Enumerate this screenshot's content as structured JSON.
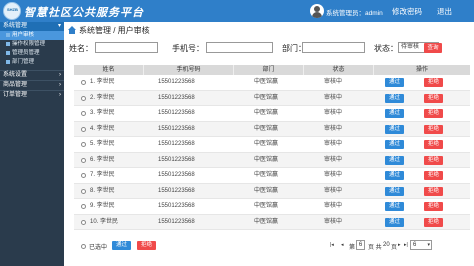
{
  "header": {
    "logo_badge": "SHZB",
    "logo_text": "智慧社区公共服务平台",
    "user_label": "系统管理员：admin",
    "change_password": "修改密码",
    "logout": "退出"
  },
  "sidebar": {
    "group1": "系统管理",
    "items": [
      "用户审核",
      "操作权限管理",
      "管理员管理",
      "部门管理"
    ],
    "group2": "系统设置",
    "group3": "商品管理",
    "group4": "订单管理"
  },
  "breadcrumb": "系统管理 / 用户审核",
  "filters": {
    "name_label": "姓名：",
    "phone_label": "手机号：",
    "dept_label": "部门：",
    "status_label": "状态：",
    "status_value": "待审核",
    "search_btn": "查询"
  },
  "table": {
    "columns": [
      "姓名",
      "手机号码",
      "部门",
      "状态",
      "操作"
    ],
    "rows": [
      {
        "name": "1. 李世民",
        "phone": "15501223568",
        "dept": "中医馆赢",
        "status": "审核中"
      },
      {
        "name": "2. 李世民",
        "phone": "15501223568",
        "dept": "中医馆赢",
        "status": "审核中"
      },
      {
        "name": "3. 李世民",
        "phone": "15501223568",
        "dept": "中医馆赢",
        "status": "审核中"
      },
      {
        "name": "4. 李世民",
        "phone": "15501223568",
        "dept": "中医馆赢",
        "status": "审核中"
      },
      {
        "name": "5. 李世民",
        "phone": "15501223568",
        "dept": "中医馆赢",
        "status": "审核中"
      },
      {
        "name": "6. 李世民",
        "phone": "15501223568",
        "dept": "中医馆赢",
        "status": "审核中"
      },
      {
        "name": "7. 李世民",
        "phone": "15501223568",
        "dept": "中医馆赢",
        "status": "审核中"
      },
      {
        "name": "8. 李世民",
        "phone": "15501223568",
        "dept": "中医馆赢",
        "status": "审核中"
      },
      {
        "name": "9. 李世民",
        "phone": "15501223568",
        "dept": "中医馆赢",
        "status": "审核中"
      },
      {
        "name": "10. 李世民",
        "phone": "15501223568",
        "dept": "中医馆赢",
        "status": "审核中"
      }
    ],
    "approve_label": "通过",
    "reject_label": "拒绝"
  },
  "footer": {
    "selected_label": "已选中",
    "approve_label": "通过",
    "reject_label": "拒绝",
    "page_prefix": "第",
    "current_page": "6",
    "page_mid": "页 共",
    "total_pages": "20",
    "page_suffix": "页",
    "page_size": "6"
  },
  "colors": {
    "header": "#2f7fc9",
    "sidebar": "#2a3b4c",
    "approve": "#2f8ad8",
    "reject": "#f04a4a"
  }
}
